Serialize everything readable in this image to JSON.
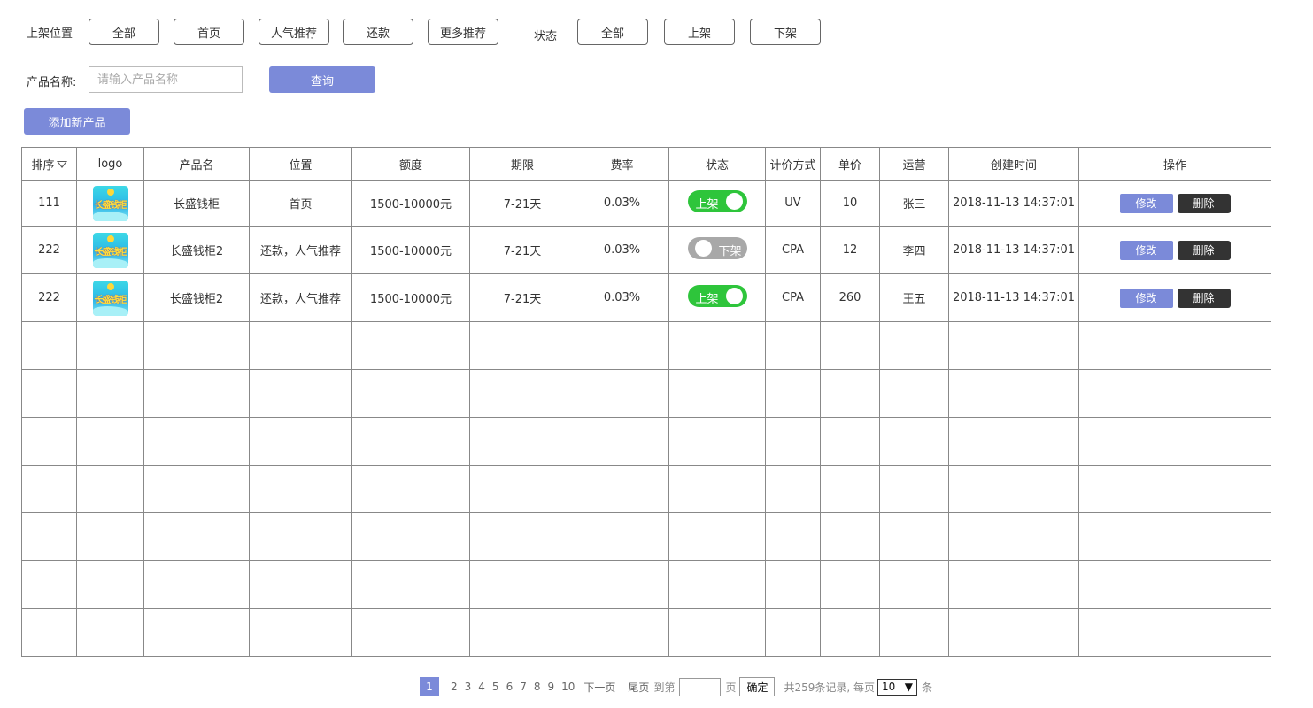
{
  "filters": {
    "position_label": "上架位置",
    "position_options": [
      "全部",
      "首页",
      "人气推荐",
      "还款",
      "更多推荐"
    ],
    "status_label": "状态",
    "status_options": [
      "全部",
      "上架",
      "下架"
    ]
  },
  "search": {
    "label": "产品名称:",
    "placeholder": "请输入产品名称",
    "value": "",
    "query_label": "查询"
  },
  "add_label": "添加新产品",
  "table": {
    "headers": [
      "排序",
      "logo",
      "产品名",
      "位置",
      "额度",
      "期限",
      "费率",
      "状态",
      "计价方式",
      "单价",
      "运营",
      "创建时间",
      "操作"
    ],
    "rows": [
      {
        "order": "111",
        "logo_text": "长盛钱柜",
        "name": "长盛钱柜",
        "position": "首页",
        "amount": "1500-10000元",
        "term": "7-21天",
        "rate": "0.03%",
        "status": "上架",
        "status_on": true,
        "pricing": "UV",
        "price": "10",
        "operator": "张三",
        "created": "2018-11-13 14:37:01",
        "edit": "修改",
        "delete": "删除"
      },
      {
        "order": "222",
        "logo_text": "长盛钱柜",
        "name": "长盛钱柜2",
        "position": "还款，人气推荐",
        "amount": "1500-10000元",
        "term": "7-21天",
        "rate": "0.03%",
        "status": "下架",
        "status_on": false,
        "pricing": "CPA",
        "price": "12",
        "operator": "李四",
        "created": "2018-11-13 14:37:01",
        "edit": "修改",
        "delete": "删除"
      },
      {
        "order": "222",
        "logo_text": "长盛钱柜",
        "name": "长盛钱柜2",
        "position": "还款，人气推荐",
        "amount": "1500-10000元",
        "term": "7-21天",
        "rate": "0.03%",
        "status": "上架",
        "status_on": true,
        "pricing": "CPA",
        "price": "260",
        "operator": "王五",
        "created": "2018-11-13 14:37:01",
        "edit": "修改",
        "delete": "删除"
      }
    ],
    "empty_rows": 7
  },
  "pager": {
    "pages": [
      "1",
      "2",
      "3",
      "4",
      "5",
      "6",
      "7",
      "8",
      "9",
      "10"
    ],
    "current": "1",
    "next": "下一页",
    "last": "尾页",
    "goto_prefix": "到第",
    "goto_suffix": "页",
    "confirm": "确定",
    "summary": "共259条记录, 每页",
    "page_size": "10",
    "unit": "条"
  },
  "colors": {
    "primary": "#7b8ad9",
    "on": "#2ec53b",
    "off": "#a8a8a8",
    "danger_dark": "#333333"
  }
}
